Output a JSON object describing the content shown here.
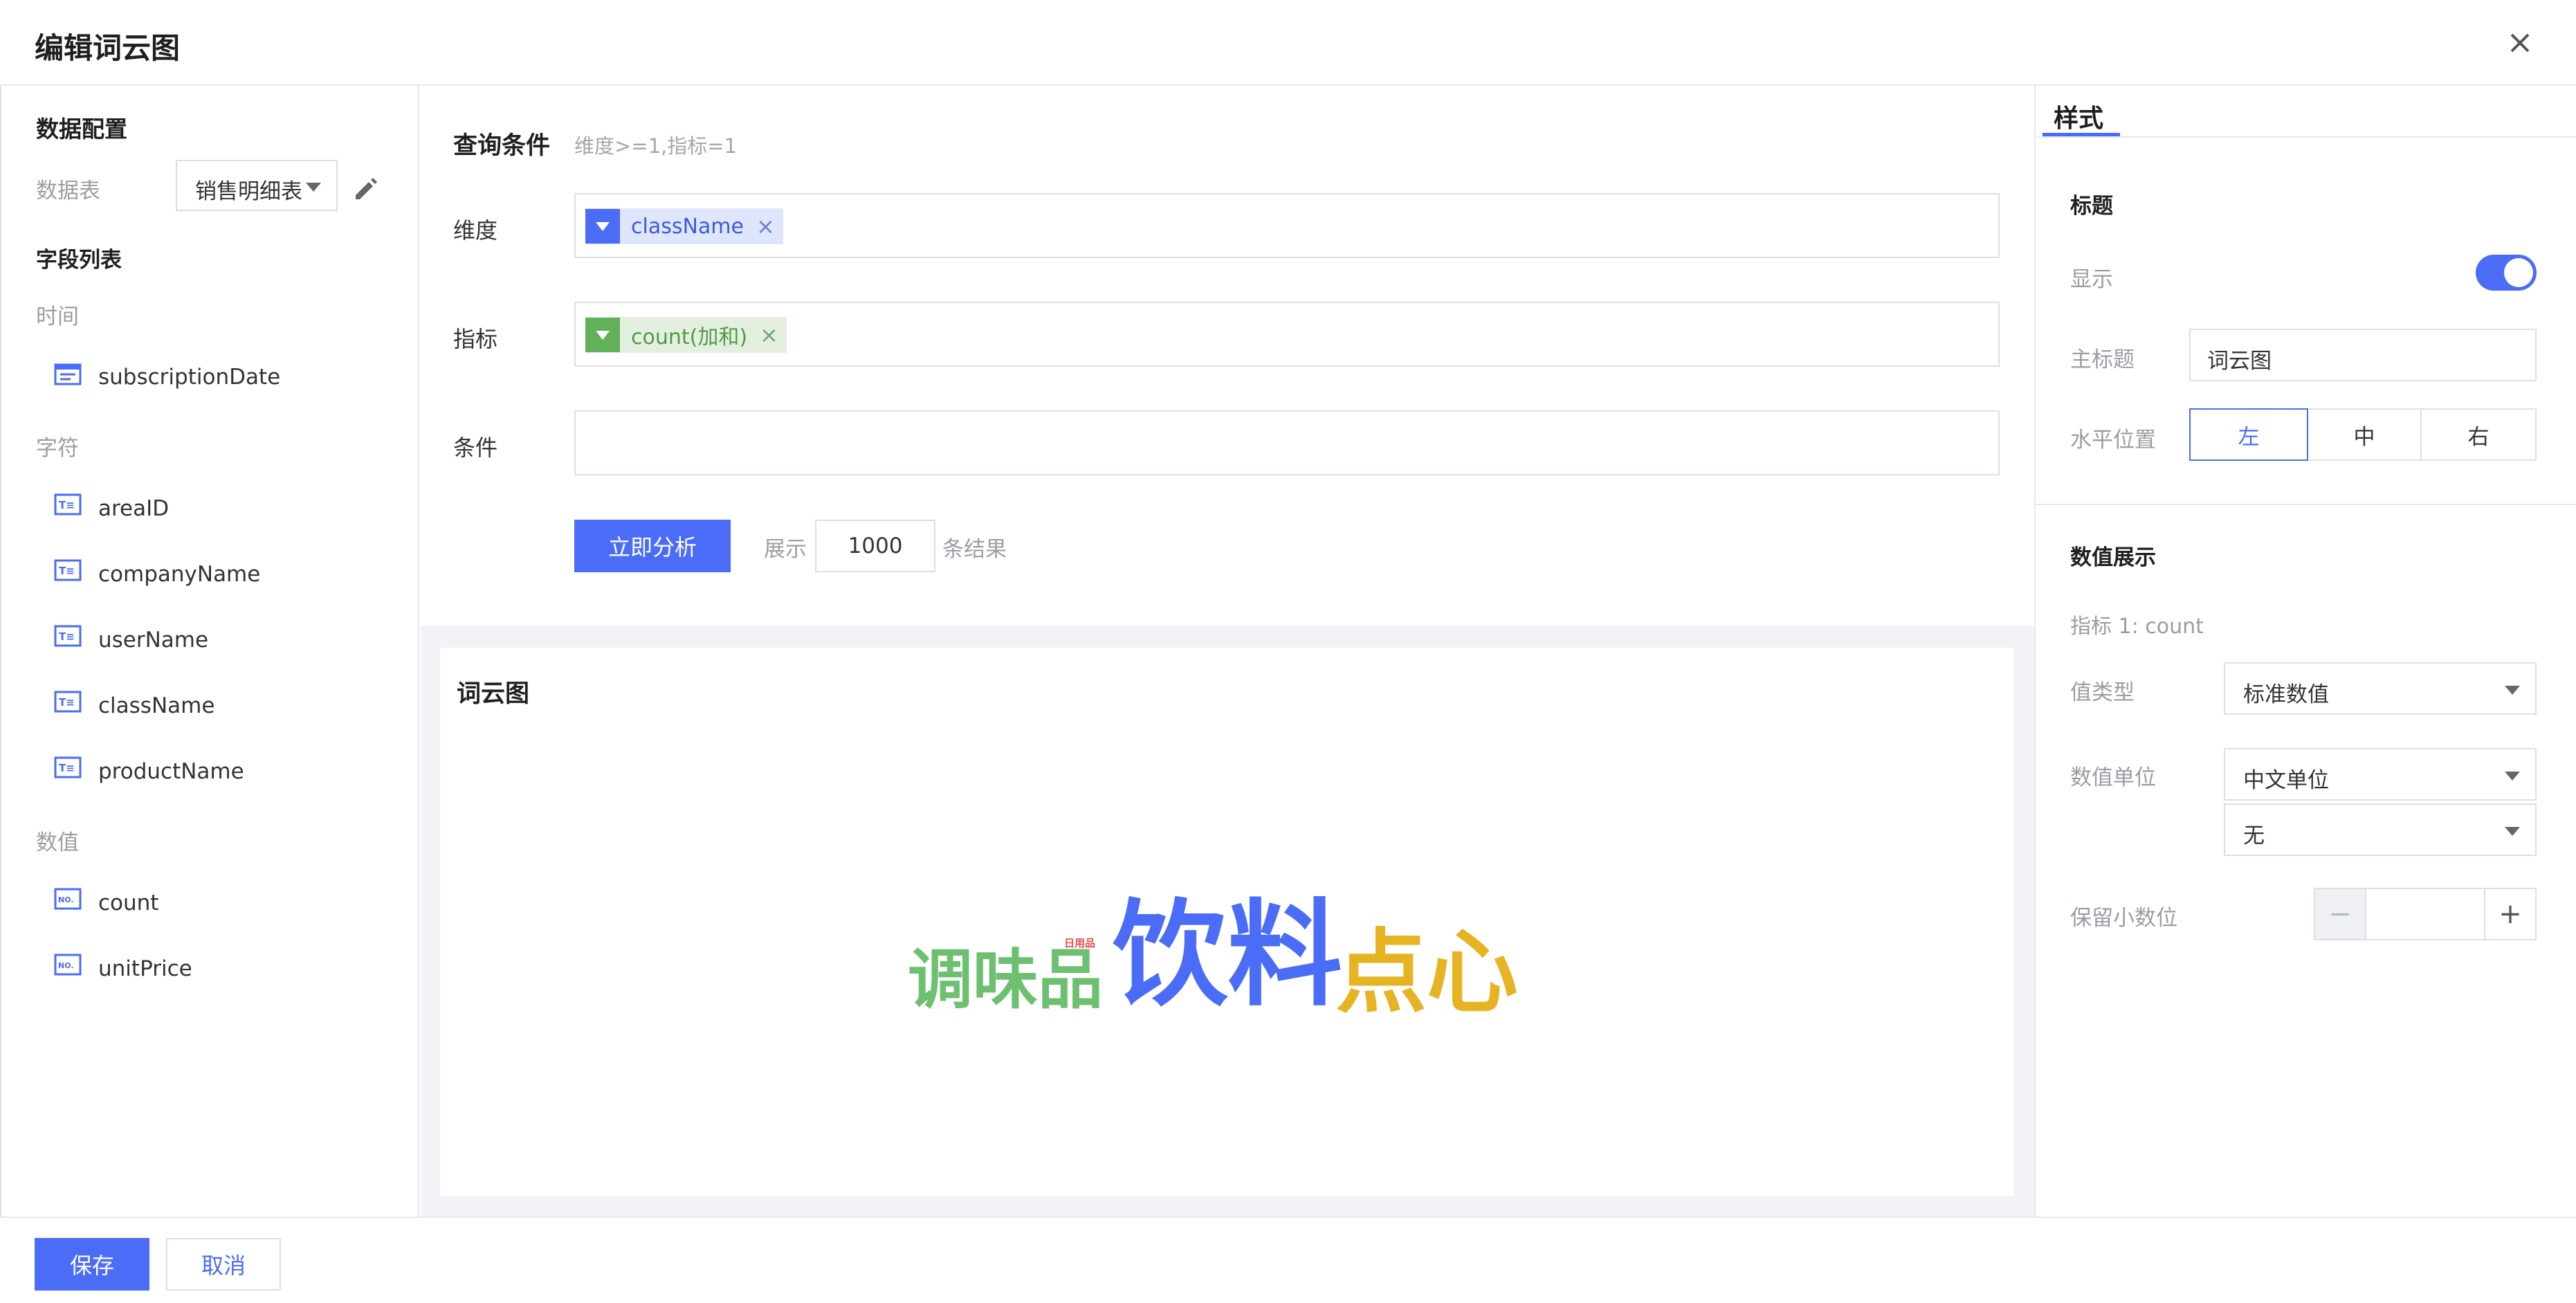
{
  "dialog": {
    "title": "编辑词云图"
  },
  "left_panel": {
    "heading": "数据配置",
    "table_label": "数据表",
    "table_value": "销售明细表",
    "field_list_heading": "字段列表",
    "groups": [
      {
        "label": "时间",
        "fields": [
          {
            "name": "subscriptionDate",
            "icon": "calendar-icon"
          }
        ]
      },
      {
        "label": "字符",
        "fields": [
          {
            "name": "areaID",
            "icon": "text-field-icon"
          },
          {
            "name": "companyName",
            "icon": "text-field-icon"
          },
          {
            "name": "userName",
            "icon": "text-field-icon"
          },
          {
            "name": "className",
            "icon": "text-field-icon"
          },
          {
            "name": "productName",
            "icon": "text-field-icon"
          }
        ]
      },
      {
        "label": "数值",
        "fields": [
          {
            "name": "count",
            "icon": "number-field-icon"
          },
          {
            "name": "unitPrice",
            "icon": "number-field-icon"
          }
        ]
      }
    ]
  },
  "query": {
    "heading": "查询条件",
    "hint": "维度>=1,指标=1",
    "dimension_label": "维度",
    "dimension_tag": "className",
    "metric_label": "指标",
    "metric_tag": "count(加和)",
    "condition_label": "条件",
    "analyze_button": "立即分析",
    "show_label": "展示",
    "limit_value": "1000",
    "result_suffix": "条结果"
  },
  "chart": {
    "title": "词云图",
    "chart_data": {
      "type": "wordcloud",
      "words": [
        {
          "text": "饮料",
          "color": "#4a6cf7"
        },
        {
          "text": "点心",
          "color": "#e6b422"
        },
        {
          "text": "调味品",
          "color": "#6cc070"
        },
        {
          "text": "日用品",
          "color": "#e84a4a"
        }
      ]
    }
  },
  "style_panel": {
    "tab": "样式",
    "title_section": "标题",
    "show_label": "显示",
    "show_on": true,
    "main_title_label": "主标题",
    "main_title_value": "词云图",
    "h_position_label": "水平位置",
    "h_positions": [
      "左",
      "中",
      "右"
    ],
    "h_position_selected": "左",
    "value_section": "数值展示",
    "metric_note": "指标 1: count",
    "value_type_label": "值类型",
    "value_type": "标准数值",
    "unit_label": "数值单位",
    "unit_value": "中文单位",
    "unit_sub_value": "无",
    "decimal_label": "保留小数位",
    "decimal_value": ""
  },
  "footer": {
    "save": "保存",
    "cancel": "取消"
  },
  "colors": {
    "accent": "#4a6cf7",
    "metric_tag_bg": "#e3f0df",
    "metric_tag_icon": "#62b05a",
    "dim_tag_bg": "#dfe6fb"
  }
}
